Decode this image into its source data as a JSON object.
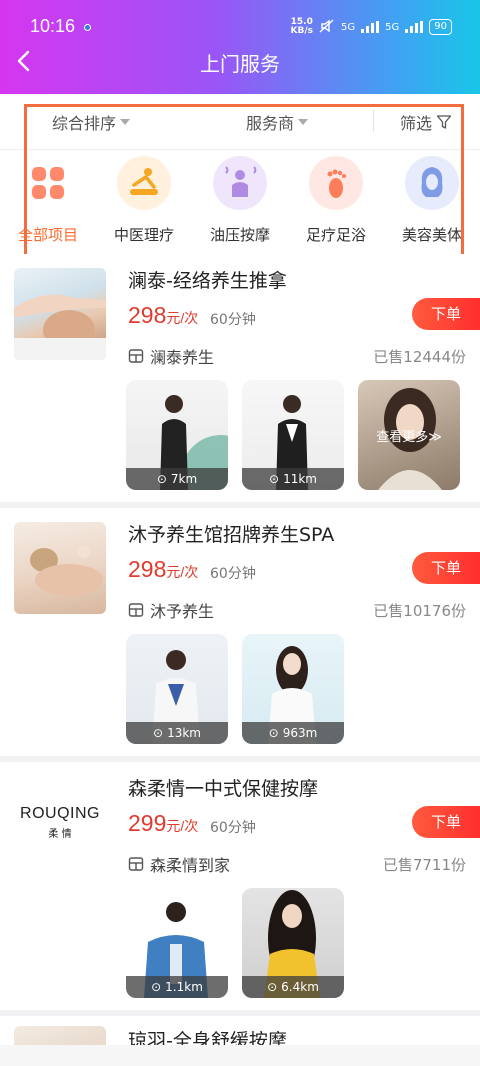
{
  "status": {
    "time": "10:16",
    "speed_top": "15.0",
    "speed_bottom": "KB/s",
    "net1": "5G",
    "net2": "5G",
    "battery": "90"
  },
  "nav": {
    "title": "上门服务"
  },
  "filters": {
    "sort": "综合排序",
    "provider": "服务商",
    "filter": "筛选"
  },
  "categories": [
    {
      "label": "全部项目",
      "icon": "four-petal-icon"
    },
    {
      "label": "中医理疗",
      "icon": "massage-icon"
    },
    {
      "label": "油压按摩",
      "icon": "oil-massage-icon"
    },
    {
      "label": "足疗足浴",
      "icon": "foot-icon"
    },
    {
      "label": "美容美体",
      "icon": "beauty-icon"
    }
  ],
  "listings": [
    {
      "name": "澜泰-经络养生推拿",
      "price": "298",
      "unit": "元/次",
      "duration": "60分钟",
      "store": "澜泰养生",
      "sold": "已售12444份",
      "order": "下单",
      "techs": [
        {
          "dist": "7km"
        },
        {
          "dist": "11km"
        }
      ],
      "more": "查看更多≫"
    },
    {
      "name": "沐予养生馆招牌养生SPA",
      "price": "298",
      "unit": "元/次",
      "duration": "60分钟",
      "store": "沐予养生",
      "sold": "已售10176份",
      "order": "下单",
      "techs": [
        {
          "dist": "13km"
        },
        {
          "dist": "963m"
        }
      ]
    },
    {
      "name": "森柔情一中式保健按摩",
      "price": "299",
      "unit": "元/次",
      "duration": "60分钟",
      "store": "森柔情到家",
      "sold": "已售7711份",
      "order": "下单",
      "logo_text": "ROUQING",
      "logo_sub": "柔 情",
      "techs": [
        {
          "dist": "1.1km"
        },
        {
          "dist": "6.4km"
        }
      ]
    },
    {
      "name": "琼羽-全身舒缓按摩"
    }
  ],
  "colors": {
    "accent": "#ff6a2b",
    "price": "#e13b2e",
    "order_btn": "#ff3b30",
    "highlight": "#f36d3e"
  }
}
